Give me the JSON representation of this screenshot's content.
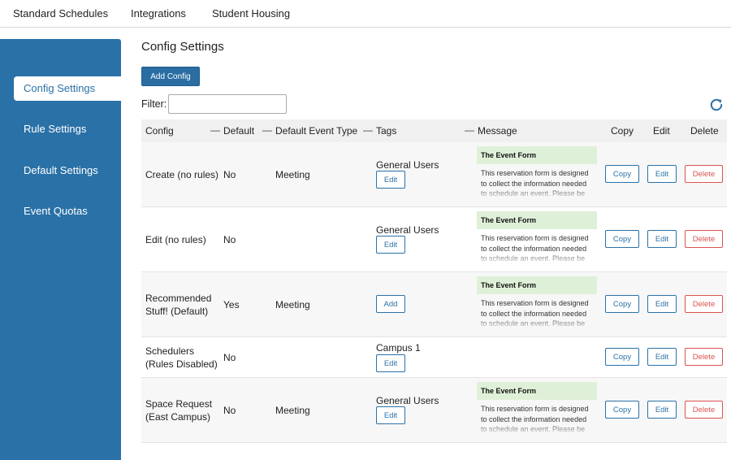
{
  "topnav": {
    "tabs": [
      {
        "label": "Standard Schedules"
      },
      {
        "label": "Integrations"
      },
      {
        "label": "Student Housing"
      }
    ]
  },
  "sidebar": {
    "items": [
      {
        "label": "Config Settings",
        "active": true
      },
      {
        "label": "Rule Settings"
      },
      {
        "label": "Default Settings"
      },
      {
        "label": "Event Quotas"
      }
    ]
  },
  "page": {
    "title": "Config Settings",
    "add_button": "Add Config",
    "filter_label": "Filter:",
    "filter_value": "",
    "refresh_icon": "refresh-icon"
  },
  "table": {
    "headers": {
      "config": "Config",
      "default": "Default",
      "default_event_type": "Default Event Type",
      "tags": "Tags",
      "message": "Message",
      "copy": "Copy",
      "edit": "Edit",
      "delete": "Delete",
      "sort_mark": "—"
    },
    "rows": [
      {
        "config": "Create (no rules)",
        "default": "No",
        "event_type": "Meeting",
        "tag": "General Users",
        "tag_button": "Edit",
        "msg_title": "The Event Form",
        "msg_body": "This reservation form is designed to collect the information needed to schedule an event. Please be as",
        "copy": "Copy",
        "edit": "Edit",
        "delete": "Delete"
      },
      {
        "config": "Edit (no rules)",
        "default": "No",
        "event_type": "",
        "tag": "General Users",
        "tag_button": "Edit",
        "msg_title": "The Event Form",
        "msg_body": "This reservation form is designed to collect the information needed to schedule an event. Please be as",
        "copy": "Copy",
        "edit": "Edit",
        "delete": "Delete"
      },
      {
        "config": "Recommended Stuff! (Default)",
        "default": "Yes",
        "event_type": "Meeting",
        "tag": "",
        "tag_button": "Add",
        "msg_title": "The Event Form",
        "msg_body": "This reservation form is designed to collect the information needed to schedule an event. Please be as",
        "copy": "Copy",
        "edit": "Edit",
        "delete": "Delete"
      },
      {
        "config": "Schedulers (Rules Disabled)",
        "default": "No",
        "event_type": "",
        "tag": "Campus 1",
        "tag_button": "Edit",
        "msg_title": "",
        "msg_body": "",
        "copy": "Copy",
        "edit": "Edit",
        "delete": "Delete"
      },
      {
        "config": "Space Request (East Campus)",
        "default": "No",
        "event_type": "Meeting",
        "tag": "General Users",
        "tag_button": "Edit",
        "msg_title": "The Event Form",
        "msg_body": "This reservation form is designed to collect the information needed to schedule an event. Please be as",
        "copy": "Copy",
        "edit": "Edit",
        "delete": "Delete"
      }
    ]
  },
  "colors": {
    "brand_blue": "#2a71a7",
    "danger": "#d9534f",
    "message_header_bg": "#dff0d8"
  }
}
